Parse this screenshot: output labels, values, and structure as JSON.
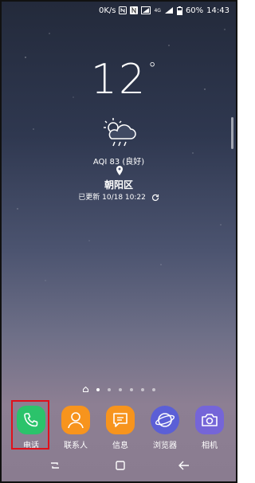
{
  "status_bar": {
    "net_speed": "0K/s",
    "network_type": "4G",
    "battery": "60%",
    "time": "14:43",
    "icons": [
      "nfc-icon",
      "n-badge-icon",
      "signal-icon",
      "wifi-icon",
      "battery-icon"
    ]
  },
  "weather": {
    "temperature": "12",
    "degree_symbol": "°",
    "condition_icon": "sun-cloud-rain-icon",
    "aqi": "AQI 83 (良好)",
    "location": "朝阳区",
    "updated": "已更新 10/18 10:22"
  },
  "page_indicator": {
    "count": 7,
    "active_index": 1
  },
  "dock": [
    {
      "label": "电话",
      "icon": "phone-icon",
      "color": "#2bc36b"
    },
    {
      "label": "联系人",
      "icon": "contacts-icon",
      "color": "#f7941d"
    },
    {
      "label": "信息",
      "icon": "message-icon",
      "color": "#f7941d"
    },
    {
      "label": "浏览器",
      "icon": "browser-icon",
      "color": "#5b5fd6"
    },
    {
      "label": "相机",
      "icon": "camera-icon",
      "color": "#7565d8"
    }
  ],
  "highlight_color": "#e0101b",
  "nav_bar": [
    "recent-apps-icon",
    "home-icon",
    "back-icon"
  ]
}
